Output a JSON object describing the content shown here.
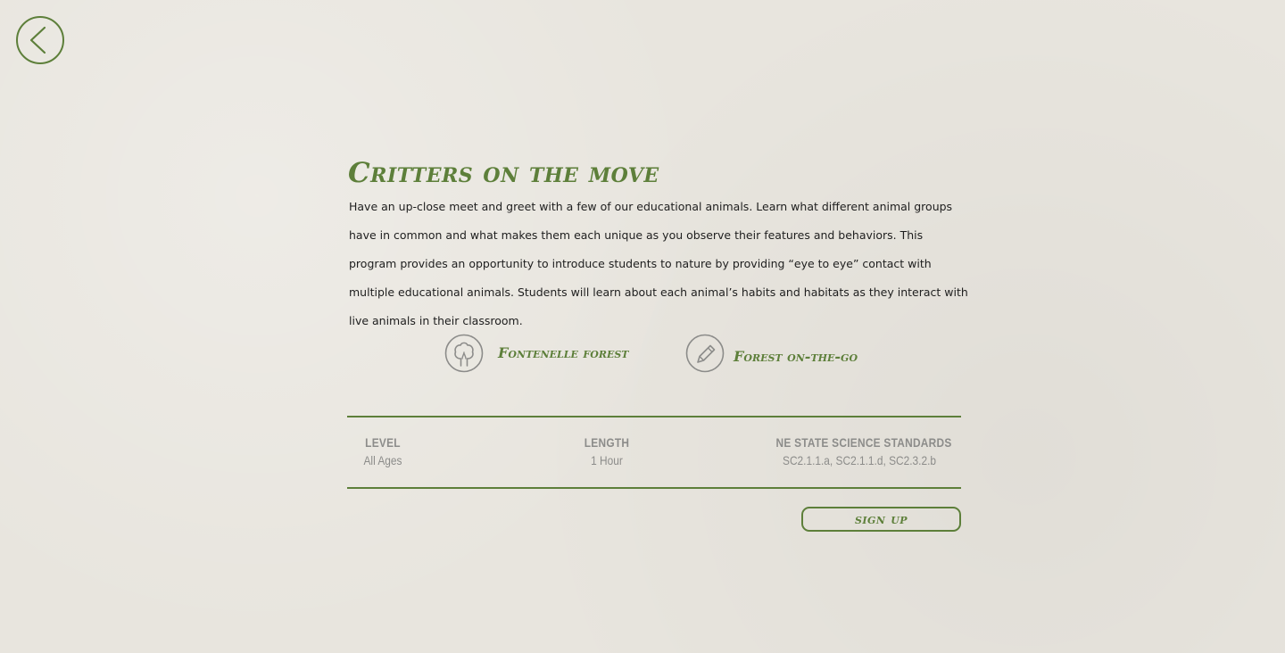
{
  "nav": {
    "back_icon": "chevron-left-icon"
  },
  "program": {
    "title": "Critters on the move",
    "description": "Have an up-close meet and greet with a few of our educational animals. Learn what different animal groups have in common and what makes them each unique as you observe their features and behaviors. This program provides an opportunity to introduce students to nature by providing “eye to eye” contact with multiple educational animals. Students will learn about each animal’s habits and habitats as they interact with live animals in their classroom."
  },
  "locations": [
    {
      "label": "Fontenelle forest",
      "icon": "tree-icon"
    },
    {
      "label": "Forest on-the-go",
      "icon": "pencil-icon"
    }
  ],
  "info": {
    "level_label": "LEVEL",
    "level_value": "All Ages",
    "length_label": "LENGTH",
    "length_value": "1 Hour",
    "standards_label": "NE STATE SCIENCE STANDARDS",
    "standards_value": "SC2.1.1.a, SC2.1.1.d, SC2.3.2.b"
  },
  "actions": {
    "signup_label": "sign up"
  },
  "colors": {
    "accent": "#5d7f3a",
    "muted_text": "#8c8c8a",
    "background": "#e8e5de"
  }
}
